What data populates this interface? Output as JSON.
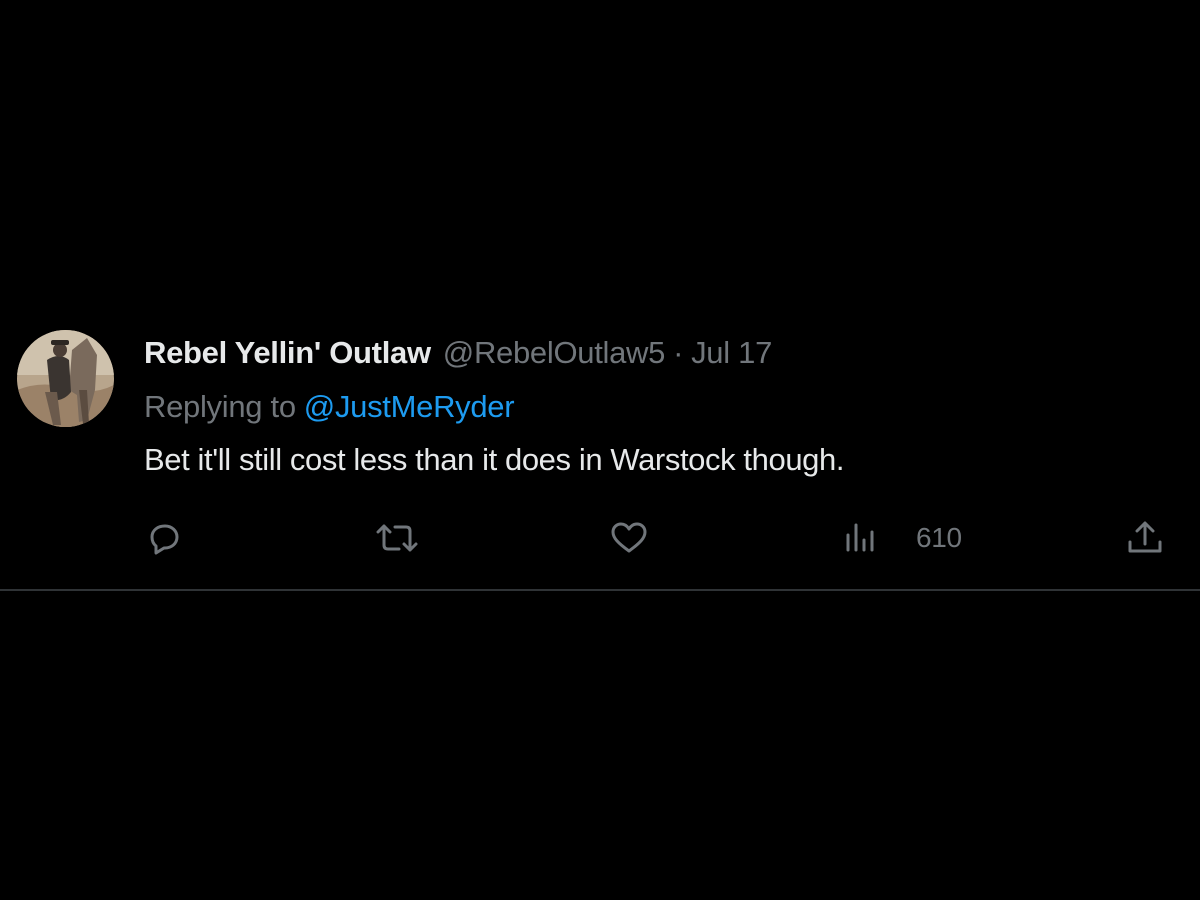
{
  "tweet": {
    "display_name": "Rebel Yellin' Outlaw",
    "handle": "@RebelOutlaw5",
    "separator": "·",
    "date": "Jul 17",
    "reply_prefix": "Replying to",
    "reply_to": "@JustMeRyder",
    "text": "Bet it'll still cost less than it does in Warstock though.",
    "avatar_icon": "avatar-rider-on-horse",
    "actions": {
      "reply_icon": "reply-icon",
      "retweet_icon": "retweet-icon",
      "like_icon": "heart-icon",
      "views_icon": "views-icon",
      "views_count": "610",
      "share_icon": "share-icon"
    }
  },
  "colors": {
    "background": "#000000",
    "primary_text": "#e7e9ea",
    "secondary_text": "#71767b",
    "link": "#1d9bf0",
    "divider": "#2f3336"
  }
}
